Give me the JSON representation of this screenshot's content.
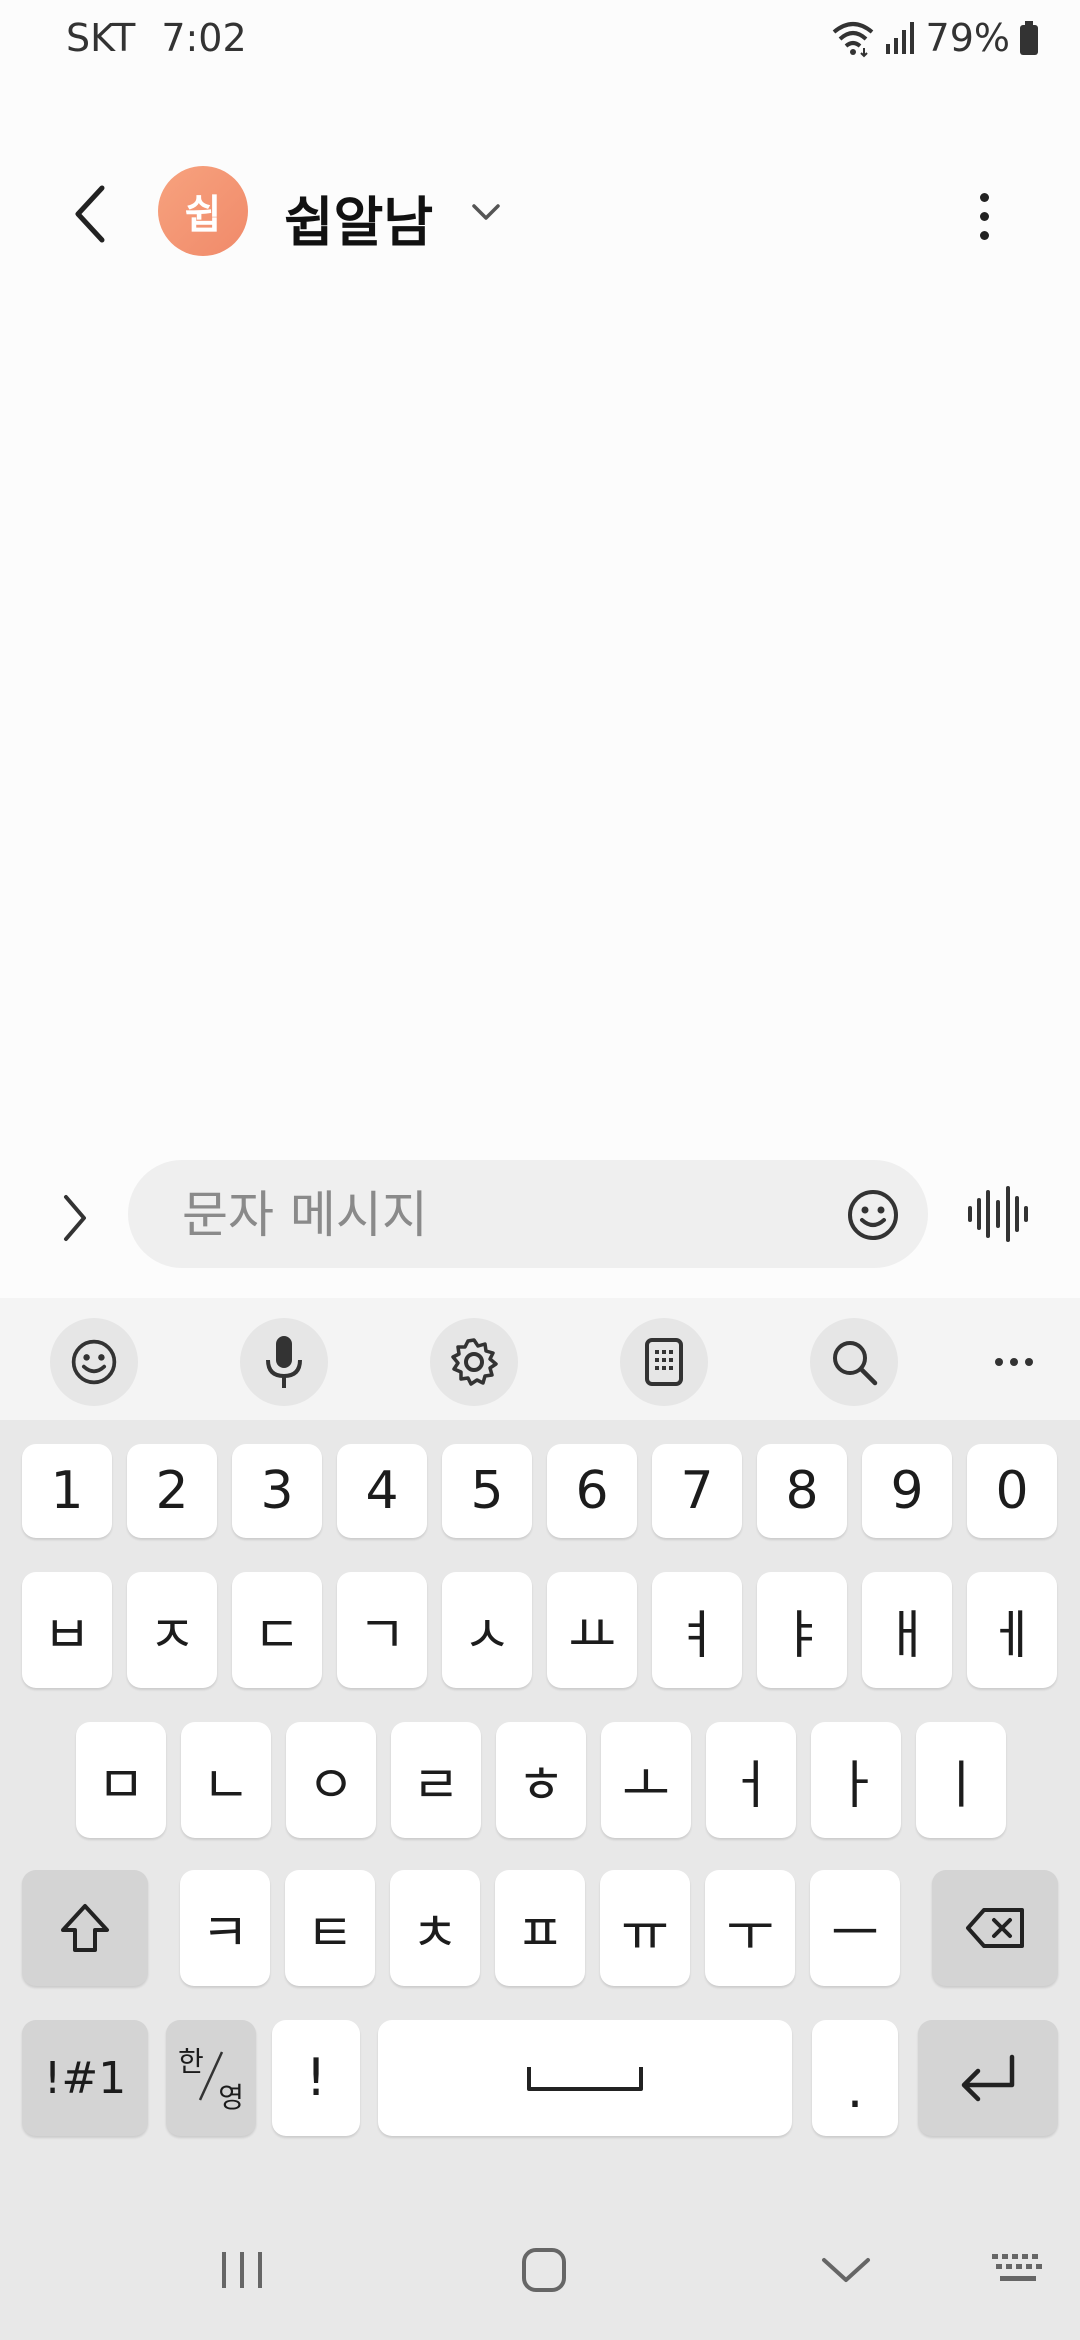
{
  "status_bar": {
    "carrier": "SKT",
    "time": "7:02",
    "battery": "79%"
  },
  "header": {
    "avatar_initial": "쉽",
    "contact_name": "쉽알남"
  },
  "composer": {
    "placeholder": "문자 메시지"
  },
  "keyboard": {
    "toolbar": [
      "emoji-icon",
      "mic-icon",
      "gear-icon",
      "keypad-icon",
      "search-icon",
      "more-icon"
    ],
    "number_row": [
      "1",
      "2",
      "3",
      "4",
      "5",
      "6",
      "7",
      "8",
      "9",
      "0"
    ],
    "row1": [
      "ㅂ",
      "ㅈ",
      "ㄷ",
      "ㄱ",
      "ㅅ",
      "ㅛ",
      "ㅕ",
      "ㅑ",
      "ㅐ",
      "ㅔ"
    ],
    "row2": [
      "ㅁ",
      "ㄴ",
      "ㅇ",
      "ㄹ",
      "ㅎ",
      "ㅗ",
      "ㅓ",
      "ㅏ",
      "ㅣ"
    ],
    "row3": [
      "ㅋ",
      "ㅌ",
      "ㅊ",
      "ㅍ",
      "ㅠ",
      "ㅜ",
      "ㅡ"
    ],
    "symbols_label": "!#1",
    "han_label": "한",
    "eng_label": "영",
    "exclaim_label": "!",
    "period_label": "."
  },
  "colors": {
    "avatar_gradient_start": "#f7a27e",
    "avatar_gradient_end": "#f08a6a",
    "keyboard_bg": "#e8e8e8",
    "key_bg": "#ffffff",
    "fn_key_bg": "#d4d4d4"
  }
}
